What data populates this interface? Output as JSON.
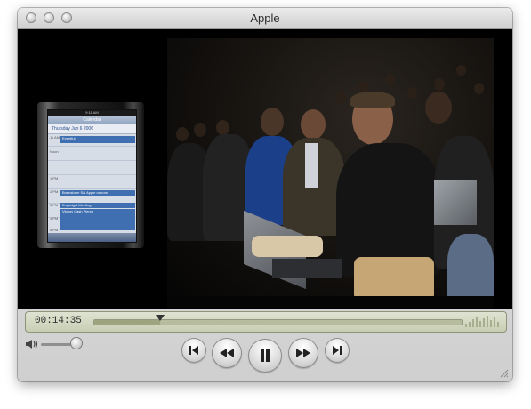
{
  "window": {
    "title": "Apple"
  },
  "phone": {
    "status": "9:11 AM",
    "header": "Calendar",
    "day": "Thursday   Jun 6 2006",
    "events": [
      {
        "label": "Eventful"
      },
      {
        "label": "Brainstorm Sal Apple rumors"
      },
      {
        "label": "Engadget Meeting"
      },
      {
        "label": "Victory Cash Pierce"
      }
    ],
    "hours": [
      "11 AM",
      "Noon",
      "1 PM",
      "2 PM",
      "3 PM",
      "4 PM",
      "5 PM"
    ],
    "tabs": [
      "Today",
      "List",
      "Day",
      "Month",
      "+"
    ]
  },
  "playback": {
    "time": "00:14:35",
    "progress": 0.18
  },
  "volume": {
    "level": 0.78
  },
  "controls": {
    "buttons": [
      "skip-back",
      "rewind",
      "pause",
      "fast-forward",
      "skip-forward"
    ]
  }
}
